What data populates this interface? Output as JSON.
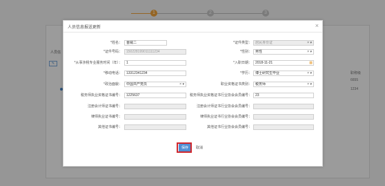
{
  "background": {
    "steps": [
      "1",
      "2",
      "3"
    ],
    "table_label": "人员信",
    "toolbar_icon": "edit-icon",
    "right_col_header": "职称级",
    "right_values": [
      "6655",
      "1234"
    ]
  },
  "modal": {
    "title": "人员信息报送更新",
    "close": "×",
    "left_fields": [
      {
        "label": "*姓名：",
        "value": "晋威二",
        "state": "normal"
      },
      {
        "label": "*证件号码：",
        "value": "150228199011111234",
        "state": "disabled"
      },
      {
        "label": "*从事涉税专业服务时间（年）：",
        "value": "1",
        "state": "normal"
      },
      {
        "label": "*移动电话：",
        "value": "13312341234",
        "state": "normal"
      },
      {
        "label": "*政治面貌：",
        "value": "中国共产党员",
        "state": "select"
      },
      {
        "label": "税务师执业资格证书编号：",
        "value": "1225637",
        "state": "normal"
      },
      {
        "label": "注册会计师证书编号：",
        "value": "",
        "state": "disabled"
      },
      {
        "label": "律师执业证书编号：",
        "value": "",
        "state": "disabled"
      },
      {
        "label": "其他证书编号：",
        "value": "",
        "state": "disabled"
      }
    ],
    "right_fields": [
      {
        "label": "*证件类型：",
        "value": "居民身份证",
        "state": "select-disabled"
      },
      {
        "label": "*性别：",
        "value": "男性",
        "state": "select"
      },
      {
        "label": "*入职日期：",
        "value": "2018-11-21",
        "state": "date"
      },
      {
        "label": "*学历：",
        "value": "博士研究生毕业",
        "state": "select"
      },
      {
        "label": "职业资格证书类别：",
        "value": "税务师",
        "state": "select"
      },
      {
        "label": "税务师执业资格证书行业协会会员编号：",
        "value": "23",
        "state": "normal"
      },
      {
        "label": "注册会计师证书行业协会会员编号：",
        "value": "",
        "state": "disabled"
      },
      {
        "label": "律师执业证书行业协会会员编号：",
        "value": "",
        "state": "disabled"
      },
      {
        "label": "其他证书行业协会会员编号：",
        "value": "",
        "state": "disabled"
      }
    ],
    "save_label": "保存",
    "cancel_label": "取消"
  },
  "colors": {
    "primary": "#4f8fd4",
    "highlight": "#d0262c",
    "required": "#e33333"
  }
}
